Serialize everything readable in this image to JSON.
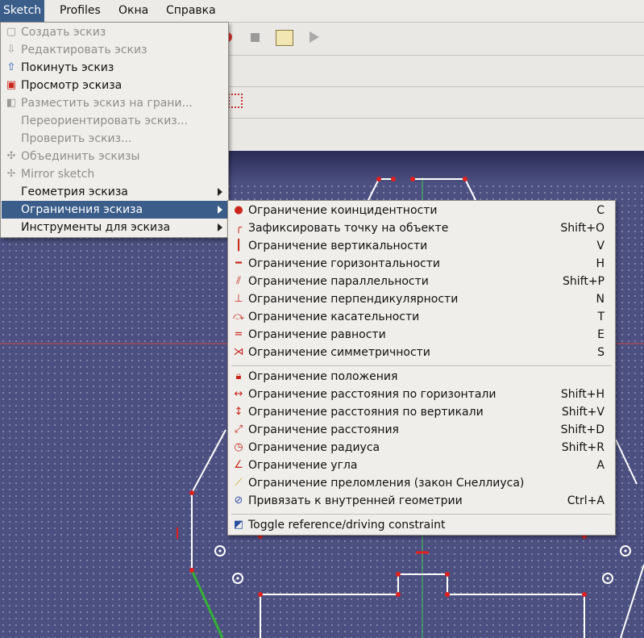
{
  "menubar": {
    "items": [
      {
        "label": "Sketch",
        "active": true
      },
      {
        "label": "Profiles"
      },
      {
        "label": "Окна"
      },
      {
        "label": "Справка"
      }
    ]
  },
  "sketch_menu": {
    "items": [
      {
        "label": "Создать эскиз",
        "disabled": true,
        "icon": "new-sketch-icon"
      },
      {
        "label": "Редактировать эскиз",
        "disabled": true,
        "icon": "edit-sketch-icon"
      },
      {
        "label": "Покинуть эскиз",
        "disabled": false,
        "icon": "leave-sketch-icon"
      },
      {
        "label": "Просмотр эскиза",
        "disabled": false,
        "icon": "view-sketch-icon"
      },
      {
        "label": "Разместить эскиз на грани...",
        "disabled": true,
        "icon": "map-sketch-icon"
      },
      {
        "label": "Переориентировать эскиз...",
        "disabled": true,
        "icon": ""
      },
      {
        "label": "Проверить эскиз...",
        "disabled": true,
        "icon": ""
      },
      {
        "label": "Объединить эскизы",
        "disabled": true,
        "icon": "merge-sketches-icon"
      },
      {
        "label": "Mirror sketch",
        "disabled": true,
        "icon": "mirror-sketch-icon"
      },
      {
        "label": "Геометрия эскиза",
        "submenu": true
      },
      {
        "label": "Ограничения эскиза",
        "submenu": true,
        "highlighted": true
      },
      {
        "label": "Инструменты для эскиза",
        "submenu": true
      }
    ]
  },
  "constraints_menu": {
    "items": [
      {
        "label": "Ограничение коинцидентности",
        "shortcut": "C",
        "icon": "coincident-icon"
      },
      {
        "label": "Зафиксировать точку на объекте",
        "shortcut": "Shift+O",
        "icon": "point-on-object-icon"
      },
      {
        "label": "Ограничение вертикальности",
        "shortcut": "V",
        "icon": "vertical-icon"
      },
      {
        "label": "Ограничение горизонтальности",
        "shortcut": "H",
        "icon": "horizontal-icon"
      },
      {
        "label": "Ограничение параллельности",
        "shortcut": "Shift+P",
        "icon": "parallel-icon"
      },
      {
        "label": "Ограничение перпендикулярности",
        "shortcut": "N",
        "icon": "perpendicular-icon"
      },
      {
        "label": "Ограничение касательности",
        "shortcut": "T",
        "icon": "tangent-icon"
      },
      {
        "label": "Ограничение равности",
        "shortcut": "E",
        "icon": "equal-icon"
      },
      {
        "label": "Ограничение симметричности",
        "shortcut": "S",
        "icon": "symmetric-icon"
      },
      {
        "label": "Ограничение положения",
        "shortcut": "",
        "icon": "lock-icon"
      },
      {
        "label": "Ограничение расстояния по горизонтали",
        "shortcut": "Shift+H",
        "icon": "horizontal-distance-icon"
      },
      {
        "label": "Ограничение расстояния по вертикали",
        "shortcut": "Shift+V",
        "icon": "vertical-distance-icon"
      },
      {
        "label": "Ограничение расстояния",
        "shortcut": "Shift+D",
        "icon": "distance-icon"
      },
      {
        "label": "Ограничение радиуса",
        "shortcut": "Shift+R",
        "icon": "radius-icon"
      },
      {
        "label": "Ограничение угла",
        "shortcut": "A",
        "icon": "angle-icon"
      },
      {
        "label": "Ограничение преломления (закон Снеллиуса)",
        "shortcut": "",
        "icon": "snell-law-icon"
      },
      {
        "label": "Привязать к внутренней геометрии",
        "shortcut": "Ctrl+A",
        "icon": "internal-alignment-icon"
      },
      {
        "label": "Toggle reference/driving constraint",
        "shortcut": "",
        "icon": "toggle-driving-icon"
      }
    ]
  }
}
